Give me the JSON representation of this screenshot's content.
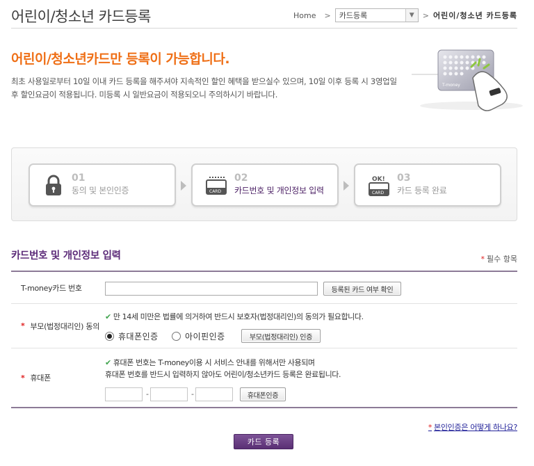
{
  "header": {
    "title": "어린이/청소년 카드등록",
    "breadcrumb": {
      "home": "Home",
      "separator": ">",
      "select_value": "카드등록",
      "current": "어린이/청소년 카드등록"
    }
  },
  "intro": {
    "headline": "어린이/청소년카드만 등록이 가능합니다.",
    "description": "최초 사용일로부터 10일 이내 카드 등록을 해주셔야 지속적인 할인 혜택을 받으실수 있으며, 10일 이후 등록 시 3영업일 후 할인요금이 적용됩니다. 미등록 시 일반요금이 적용되오니 주의하시기 바랍니다.",
    "card_brand": "T-money"
  },
  "steps": [
    {
      "num": "01",
      "label": "동의 및 본인인증",
      "icon": "lock-icon",
      "icon_text": ""
    },
    {
      "num": "02",
      "label": "카드번호 및 개인정보 입력",
      "icon": "card-icon",
      "icon_text": "CARD"
    },
    {
      "num": "03",
      "label": "카드 등록 완료",
      "icon": "card-ok-icon",
      "icon_text": "OK!"
    }
  ],
  "steps_card_label": "CARD",
  "section": {
    "title": "카드번호 및 개인정보 입력",
    "required_note": "필수 항목",
    "required_mark": "*"
  },
  "form": {
    "card_number": {
      "label": "T-money카드 번호",
      "value": "",
      "check_button": "등록된 카드 여부 확인"
    },
    "guardian": {
      "label": "부모(법정대리인) 동의",
      "notice": "만 14세 미만은 법률에 의거하여 반드시 보호자(법정대리인)의 동의가 필요합니다.",
      "options": [
        "휴대폰인증",
        "아이핀인증"
      ],
      "selected": "휴대폰인증",
      "button": "부모(법정대리인) 인증"
    },
    "phone": {
      "label": "휴대폰",
      "notice": "휴대폰 번호는 T-money이용 시 서비스 안내를 위해서만 사용되며",
      "notice2": "휴대폰 번호를 반드시 입력하지 않아도 어린이/청소년카드 등록은 완료됩니다.",
      "parts": [
        "",
        "",
        ""
      ],
      "separator": "-",
      "button": "휴대폰인증"
    }
  },
  "help_link": "본인인증은 어떻게 하나요?",
  "submit_label": "카드 등록",
  "colors": {
    "accent_orange": "#ef6f16",
    "accent_purple": "#5b2a78",
    "required_red": "#e02020",
    "check_green": "#3fa34d"
  }
}
